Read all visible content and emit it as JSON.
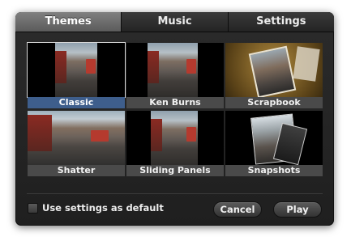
{
  "tabs": [
    {
      "label": "Themes",
      "active": true
    },
    {
      "label": "Music",
      "active": false
    },
    {
      "label": "Settings",
      "active": false
    }
  ],
  "themes": [
    {
      "label": "Classic",
      "selected": true
    },
    {
      "label": "Ken Burns",
      "selected": false
    },
    {
      "label": "Scrapbook",
      "selected": false
    },
    {
      "label": "Shatter",
      "selected": false
    },
    {
      "label": "Sliding Panels",
      "selected": false
    },
    {
      "label": "Snapshots",
      "selected": false
    }
  ],
  "footer": {
    "checkbox_label": "Use settings as default",
    "checkbox_checked": false,
    "cancel_label": "Cancel",
    "play_label": "Play"
  },
  "colors": {
    "panel_bg": "#262626",
    "selected_caption": "#3e5e8c",
    "active_tab": "#6e6e6e"
  }
}
